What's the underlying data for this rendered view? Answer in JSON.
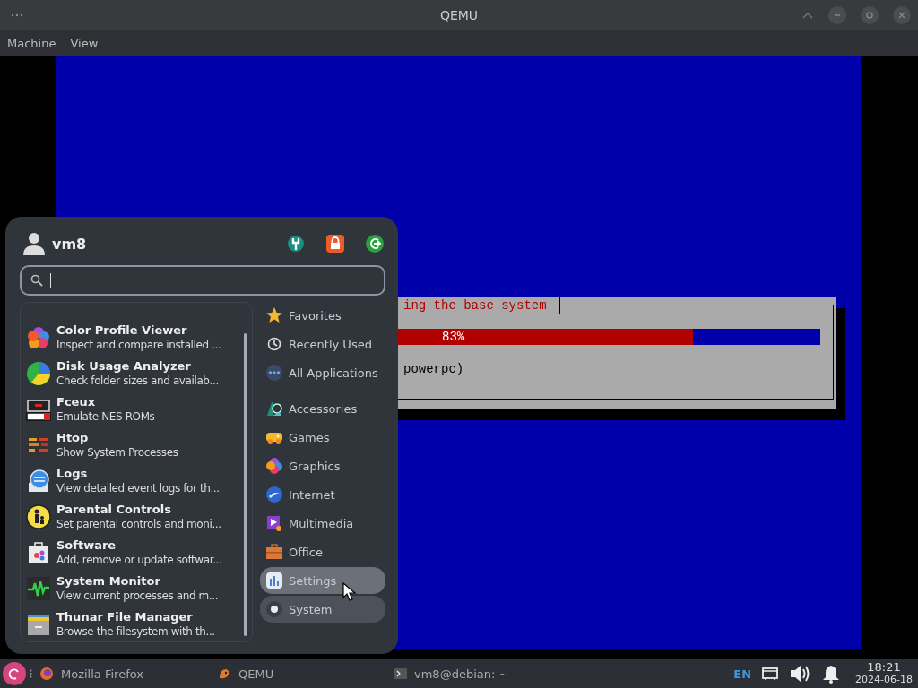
{
  "window": {
    "title": "QEMU"
  },
  "menu_bar": [
    "Machine",
    "View"
  ],
  "vm_screen": {
    "dialog": {
      "title": "ing the base system",
      "progress": {
        "level": 0.83,
        "reading": "83%"
      },
      "message": "powerpc)"
    }
  },
  "app_menu": {
    "user": "vm8",
    "apps": [
      {
        "name": "Color Profile Viewer",
        "description": "Inspect and compare installed ..."
      },
      {
        "name": "Disk Usage Analyzer",
        "description": "Check folder sizes and availab..."
      },
      {
        "name": "Fceux",
        "description": "Emulate NES ROMs"
      },
      {
        "name": "Htop",
        "description": "Show System Processes"
      },
      {
        "name": "Logs",
        "description": "View detailed event logs for th..."
      },
      {
        "name": "Parental Controls",
        "description": "Set parental controls and moni..."
      },
      {
        "name": "Software",
        "description": "Add, remove or update softwar..."
      },
      {
        "name": "System Monitor",
        "description": "View current processes and m..."
      },
      {
        "name": "Thunar File Manager",
        "description": "Browse the filesystem with th..."
      }
    ],
    "categories": [
      {
        "label": "Favorites",
        "selected": false,
        "hovered": false
      },
      {
        "label": "Recently Used",
        "selected": false,
        "hovered": false
      },
      {
        "label": "All Applications",
        "selected": false,
        "hovered": false
      },
      {
        "label": "Accessories",
        "selected": false,
        "hovered": false
      },
      {
        "label": "Games",
        "selected": false,
        "hovered": false
      },
      {
        "label": "Graphics",
        "selected": false,
        "hovered": false
      },
      {
        "label": "Internet",
        "selected": false,
        "hovered": false
      },
      {
        "label": "Multimedia",
        "selected": false,
        "hovered": false
      },
      {
        "label": "Office",
        "selected": false,
        "hovered": false
      },
      {
        "label": "Settings",
        "selected": false,
        "hovered": true
      },
      {
        "label": "System",
        "selected": true,
        "hovered": false
      }
    ]
  },
  "taskbar": {
    "windows": [
      "Mozilla Firefox",
      "QEMU",
      "vm8@debian: ~"
    ],
    "language": "EN",
    "time": "18:21",
    "date": "2024-06-18"
  }
}
